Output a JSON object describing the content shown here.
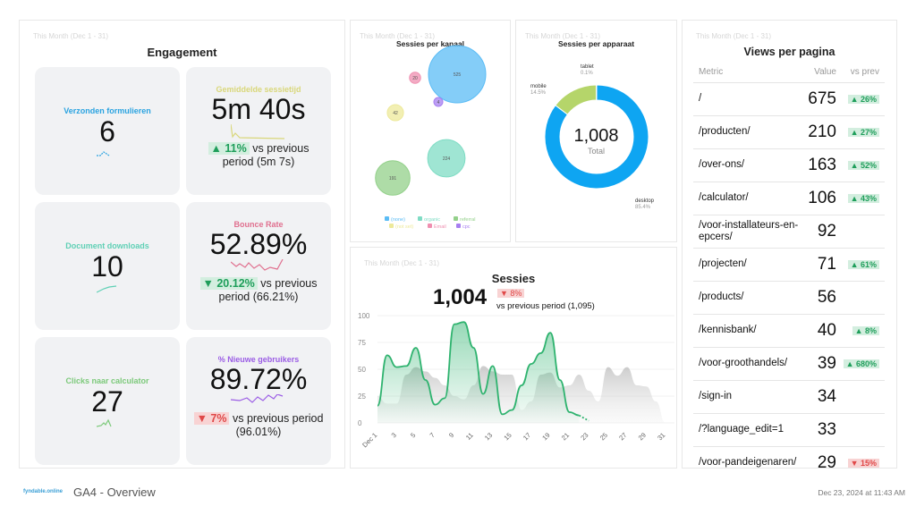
{
  "period": "This Month (Dec 1 - 31)",
  "engagement": {
    "title": "Engagement",
    "cards": [
      {
        "label": "Verzonden formulieren",
        "value": "6",
        "color": "#2aa3e0"
      },
      {
        "label": "Gemiddelde sessietijd",
        "value": "5m 40s",
        "color": "#d9d77a",
        "change": "▲ 11%",
        "change_type": "up",
        "compare": "vs previous period (5m 7s)"
      },
      {
        "label": "Document downloads",
        "value": "10",
        "color": "#5fd0b5"
      },
      {
        "label": "Bounce Rate",
        "value": "52.89%",
        "color": "#e0708f",
        "change": "▼ 20.12%",
        "change_type": "downgood",
        "compare": "vs previous period (66.21%)"
      },
      {
        "label": "Clicks naar calculator",
        "value": "27",
        "color": "#7cc97a"
      },
      {
        "label": "% Nieuwe gebruikers",
        "value": "89.72%",
        "color": "#9b5de5",
        "change": "▼ 7%",
        "change_type": "down",
        "compare": "vs previous period (96.01%)"
      }
    ]
  },
  "chart_data": [
    {
      "type": "bubble",
      "title": "Sessies per kanaal",
      "series": [
        {
          "name": "(none)",
          "value": 525,
          "color": "#5bbcf5"
        },
        {
          "name": "organic",
          "value": 224,
          "color": "#7fdcc4"
        },
        {
          "name": "referral",
          "value": 191,
          "color": "#93d08a"
        },
        {
          "name": "(not set)",
          "value": 42,
          "color": "#ede99a"
        },
        {
          "name": "Email",
          "value": 20,
          "color": "#ef8fb0"
        },
        {
          "name": "cpc",
          "value": 4,
          "color": "#a77ff0"
        }
      ]
    },
    {
      "type": "pie",
      "title": "Sessies per apparaat",
      "total": "1,008",
      "total_label": "Total",
      "slices": [
        {
          "name": "desktop",
          "value": 85.4,
          "label": "85.4%",
          "color": "#0ea5f2"
        },
        {
          "name": "mobile",
          "value": 14.5,
          "label": "14.5%",
          "color": "#b5d56a"
        },
        {
          "name": "tablet",
          "value": 0.1,
          "label": "0.1%",
          "color": "#a77ff0"
        }
      ]
    },
    {
      "type": "area",
      "title": "Sessies",
      "kpi": "1,004",
      "change": "▼ 8%",
      "compare": "vs previous period (1,095)",
      "ylim": [
        0,
        100
      ],
      "yticks": [
        0,
        25,
        50,
        75,
        100
      ],
      "xticks": [
        "Dec 1",
        "3",
        "5",
        "7",
        "9",
        "11",
        "13",
        "15",
        "17",
        "19",
        "21",
        "23",
        "25",
        "27",
        "29",
        "31"
      ],
      "series": [
        {
          "values": [
            16,
            63,
            52,
            53,
            70,
            40,
            17,
            23,
            92,
            94,
            70,
            27,
            53,
            8,
            12,
            35,
            55,
            65,
            84,
            40,
            10,
            7,
            2
          ],
          "color": "#2fb36f"
        },
        {
          "values": [
            25,
            18,
            18,
            45,
            52,
            48,
            42,
            35,
            25,
            22,
            35,
            53,
            48,
            45,
            45,
            12,
            20,
            45,
            47,
            33,
            35,
            45,
            30,
            20,
            52,
            44,
            52,
            35,
            34,
            20,
            0
          ],
          "color": "#c8c8c8"
        }
      ]
    }
  ],
  "views": {
    "title": "Views per pagina",
    "headers": [
      "Metric",
      "Value",
      "vs prev"
    ],
    "rows": [
      {
        "metric": "/",
        "value": "675",
        "change": "▲ 26%",
        "type": "up"
      },
      {
        "metric": "/producten/",
        "value": "210",
        "change": "▲ 27%",
        "type": "up"
      },
      {
        "metric": "/over-ons/",
        "value": "163",
        "change": "▲ 52%",
        "type": "up"
      },
      {
        "metric": "/calculator/",
        "value": "106",
        "change": "▲ 43%",
        "type": "up"
      },
      {
        "metric": "/voor-installateurs-en-epcers/",
        "value": "92",
        "change": "",
        "type": ""
      },
      {
        "metric": "/projecten/",
        "value": "71",
        "change": "▲ 61%",
        "type": "up"
      },
      {
        "metric": "/products/",
        "value": "56",
        "change": "",
        "type": ""
      },
      {
        "metric": "/kennisbank/",
        "value": "40",
        "change": "▲ 8%",
        "type": "up"
      },
      {
        "metric": "/voor-groothandels/",
        "value": "39",
        "change": "▲ 680%",
        "type": "up"
      },
      {
        "metric": "/sign-in",
        "value": "34",
        "change": "",
        "type": ""
      },
      {
        "metric": "/?language_edit=1",
        "value": "33",
        "change": "",
        "type": ""
      },
      {
        "metric": "/voor-pandeigenaren/",
        "value": "29",
        "change": "▼ 15%",
        "type": "down"
      }
    ]
  },
  "footer": {
    "logo": "fyndable.online",
    "title": "GA4 - Overview",
    "timestamp": "Dec 23, 2024 at 11:43 AM"
  }
}
